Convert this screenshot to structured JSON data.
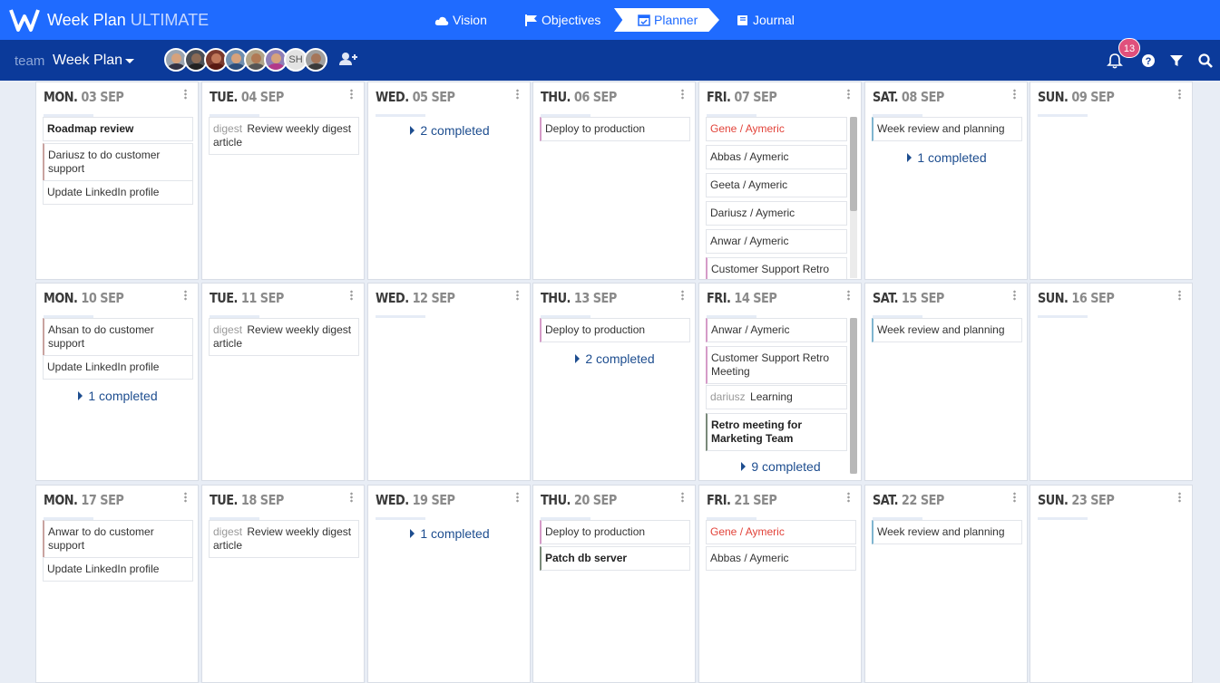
{
  "app": {
    "title": "Week Plan",
    "edition": "ULTIMATE"
  },
  "nav": {
    "tabs": [
      "Vision",
      "Objectives",
      "Planner",
      "Journal"
    ],
    "active": "Planner"
  },
  "team": {
    "label": "team",
    "name": "Week Plan",
    "avatar_initials": "SH"
  },
  "notifications": {
    "count": "13"
  },
  "weeks": [
    {
      "days": [
        {
          "dow": "MON.",
          "date": "03 SEP",
          "tasks": [
            {
              "text": "Roadmap review",
              "style": "bold"
            },
            {
              "text": "Dariusz to do customer support",
              "style": "bl"
            },
            {
              "text": "Update LinkedIn profile"
            }
          ]
        },
        {
          "dow": "TUE.",
          "date": "04 SEP",
          "tasks": [
            {
              "prefix": "digest",
              "text": "Review weekly digest article"
            }
          ]
        },
        {
          "dow": "WED.",
          "date": "05 SEP",
          "completed": "2 completed"
        },
        {
          "dow": "THU.",
          "date": "06 SEP",
          "tasks": [
            {
              "text": "Deploy to production",
              "style": "bl-pink"
            }
          ]
        },
        {
          "dow": "FRI.",
          "date": "07 SEP",
          "tasks": [
            {
              "text": "Gene / Aymeric",
              "style": "red"
            },
            {
              "text": "Abbas / Aymeric"
            },
            {
              "text": "Geeta / Aymeric"
            },
            {
              "text": "Dariusz / Aymeric"
            },
            {
              "text": "Anwar / Aymeric"
            },
            {
              "text": "Customer Support Retro",
              "style": "bl-pink"
            }
          ]
        },
        {
          "dow": "SAT.",
          "date": "08 SEP",
          "tasks": [
            {
              "text": "Week review and planning",
              "style": "bl-blue"
            }
          ],
          "completed": "1 completed"
        },
        {
          "dow": "SUN.",
          "date": "09 SEP"
        }
      ]
    },
    {
      "days": [
        {
          "dow": "MON.",
          "date": "10 SEP",
          "tasks": [
            {
              "text": "Ahsan to do customer support",
              "style": "bl"
            },
            {
              "text": "Update LinkedIn profile"
            }
          ],
          "completed": "1 completed"
        },
        {
          "dow": "TUE.",
          "date": "11 SEP",
          "tasks": [
            {
              "prefix": "digest",
              "text": "Review weekly digest article"
            }
          ]
        },
        {
          "dow": "WED.",
          "date": "12 SEP"
        },
        {
          "dow": "THU.",
          "date": "13 SEP",
          "tasks": [
            {
              "text": "Deploy to production",
              "style": "bl-pink"
            }
          ],
          "completed": "2 completed"
        },
        {
          "dow": "FRI.",
          "date": "14 SEP",
          "tasks": [
            {
              "text": "Anwar / Aymeric",
              "style": "bl-pink"
            },
            {
              "text": "Customer Support Retro Meeting",
              "style": "bl-pink"
            },
            {
              "prefix": "dariusz",
              "text": "Learning"
            },
            {
              "text": "Retro meeting for Marketing Team",
              "style": "bold bl-green"
            }
          ],
          "completed": "9 completed"
        },
        {
          "dow": "SAT.",
          "date": "15 SEP",
          "tasks": [
            {
              "text": "Week review and planning",
              "style": "bl-blue"
            }
          ]
        },
        {
          "dow": "SUN.",
          "date": "16 SEP"
        }
      ]
    },
    {
      "days": [
        {
          "dow": "MON.",
          "date": "17 SEP",
          "tasks": [
            {
              "text": "Anwar to do customer support",
              "style": "bl"
            },
            {
              "text": "Update LinkedIn profile"
            }
          ]
        },
        {
          "dow": "TUE.",
          "date": "18 SEP",
          "tasks": [
            {
              "prefix": "digest",
              "text": "Review weekly digest article"
            }
          ]
        },
        {
          "dow": "WED.",
          "date": "19 SEP",
          "completed": "1 completed"
        },
        {
          "dow": "THU.",
          "date": "20 SEP",
          "tasks": [
            {
              "text": "Deploy to production",
              "style": "bl-pink"
            },
            {
              "text": "Patch db server",
              "style": "bold bl-green"
            }
          ]
        },
        {
          "dow": "FRI.",
          "date": "21 SEP",
          "tasks": [
            {
              "text": "Gene / Aymeric",
              "style": "red"
            },
            {
              "text": "Abbas / Aymeric"
            }
          ]
        },
        {
          "dow": "SAT.",
          "date": "22 SEP",
          "tasks": [
            {
              "text": "Week review and planning",
              "style": "bl-blue"
            }
          ]
        },
        {
          "dow": "SUN.",
          "date": "23 SEP"
        }
      ]
    }
  ]
}
